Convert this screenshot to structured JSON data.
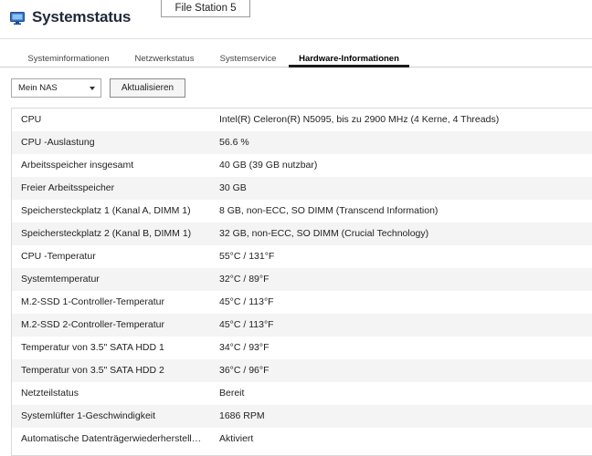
{
  "app": {
    "title": "Systemstatus",
    "icon": "monitor-icon",
    "popup_label": "File Station 5"
  },
  "tabs": [
    {
      "label": "Systeminformationen",
      "active": false
    },
    {
      "label": "Netzwerkstatus",
      "active": false
    },
    {
      "label": "Systemservice",
      "active": false
    },
    {
      "label": "Hardware-Informationen",
      "active": true
    }
  ],
  "toolbar": {
    "device_selected": "Mein NAS",
    "refresh_label": "Aktualisieren"
  },
  "hardware": [
    {
      "key": "CPU",
      "value": "Intel(R) Celeron(R) N5095, bis zu 2900 MHz (4 Kerne, 4 Threads)"
    },
    {
      "key": "CPU -Auslastung",
      "value": "56.6 %"
    },
    {
      "key": "Arbeitsspeicher insgesamt",
      "value": "40 GB (39 GB nutzbar)"
    },
    {
      "key": "Freier Arbeitsspeicher",
      "value": "30 GB"
    },
    {
      "key": "Speichersteckplatz 1 (Kanal A, DIMM 1)",
      "value": "8 GB, non-ECC, SO DIMM (Transcend Information)"
    },
    {
      "key": "Speichersteckplatz 2 (Kanal B, DIMM 1)",
      "value": "32 GB, non-ECC, SO DIMM (Crucial Technology)"
    },
    {
      "key": "CPU -Temperatur",
      "value": "55°C / 131°F"
    },
    {
      "key": "Systemtemperatur",
      "value": "32°C / 89°F"
    },
    {
      "key": "M.2-SSD 1-Controller-Temperatur",
      "value": "45°C / 113°F"
    },
    {
      "key": "M.2-SSD 2-Controller-Temperatur",
      "value": "45°C / 113°F"
    },
    {
      "key": "Temperatur von 3.5\" SATA HDD 1",
      "value": "34°C / 93°F"
    },
    {
      "key": "Temperatur von 3.5\" SATA HDD 2",
      "value": "36°C / 96°F"
    },
    {
      "key": "Netzteilstatus",
      "value": "Bereit"
    },
    {
      "key": "Systemlüfter 1-Geschwindigkeit",
      "value": "1686 RPM"
    },
    {
      "key": "Automatische Datenträgerwiederherstellung",
      "value": "Aktiviert"
    }
  ],
  "colors": {
    "app_icon": "#2f6fc4",
    "active_tab_underline": "#1a1a1a",
    "alt_row": "#f4f4f4"
  }
}
